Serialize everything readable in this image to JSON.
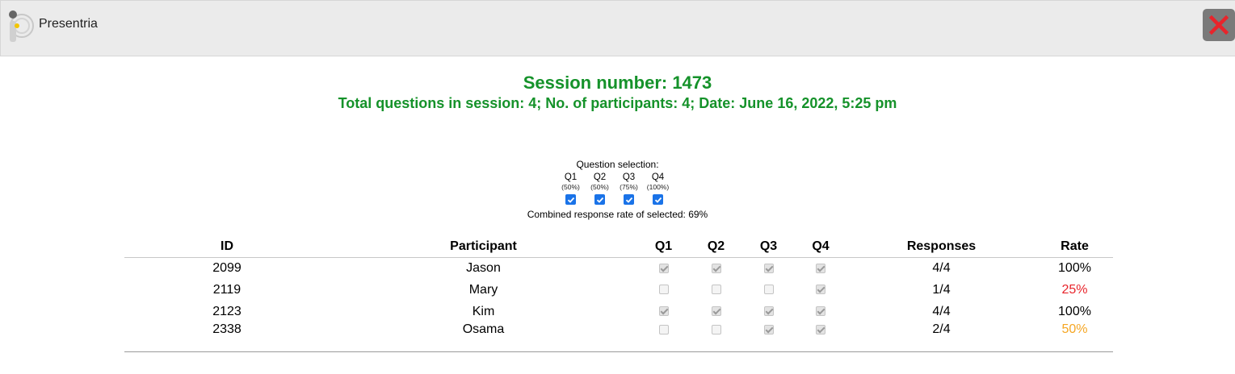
{
  "app": {
    "brand": "Presentria"
  },
  "session": {
    "title": "Session number: 1473",
    "subtitle": "Total questions in session: 4; No. of participants: 4; Date: June 16, 2022, 5:25 pm"
  },
  "question_selection": {
    "title": "Question selection:",
    "questions": [
      {
        "label": "Q1",
        "percent": "(50%)",
        "checked": true
      },
      {
        "label": "Q2",
        "percent": "(50%)",
        "checked": true
      },
      {
        "label": "Q3",
        "percent": "(75%)",
        "checked": true
      },
      {
        "label": "Q4",
        "percent": "(100%)",
        "checked": true
      }
    ],
    "combined": "Combined response rate of selected: 69%"
  },
  "table": {
    "headers": [
      "ID",
      "Participant",
      "Q1",
      "Q2",
      "Q3",
      "Q4",
      "Responses",
      "Rate"
    ],
    "rows": [
      {
        "id": "2099",
        "name": "Jason",
        "answers": [
          true,
          true,
          true,
          true
        ],
        "responses": "4/4",
        "rate": "100%",
        "rate_color": "#000000"
      },
      {
        "id": "2119",
        "name": "Mary",
        "answers": [
          false,
          false,
          false,
          true
        ],
        "responses": "1/4",
        "rate": "25%",
        "rate_color": "#e8242b"
      },
      {
        "id": "2123",
        "name": "Kim",
        "answers": [
          true,
          true,
          true,
          true
        ],
        "responses": "4/4",
        "rate": "100%",
        "rate_color": "#000000"
      },
      {
        "id": "2338",
        "name": "Osama",
        "answers": [
          false,
          false,
          true,
          true
        ],
        "responses": "2/4",
        "rate": "50%",
        "rate_color": "#f5a623"
      }
    ]
  },
  "colors": {
    "heading": "#15922a",
    "checkbox_accent": "#1a73e8",
    "close_x": "#e8242b"
  },
  "icons": {
    "logo": "presentria-logo-icon",
    "close": "close-icon"
  }
}
